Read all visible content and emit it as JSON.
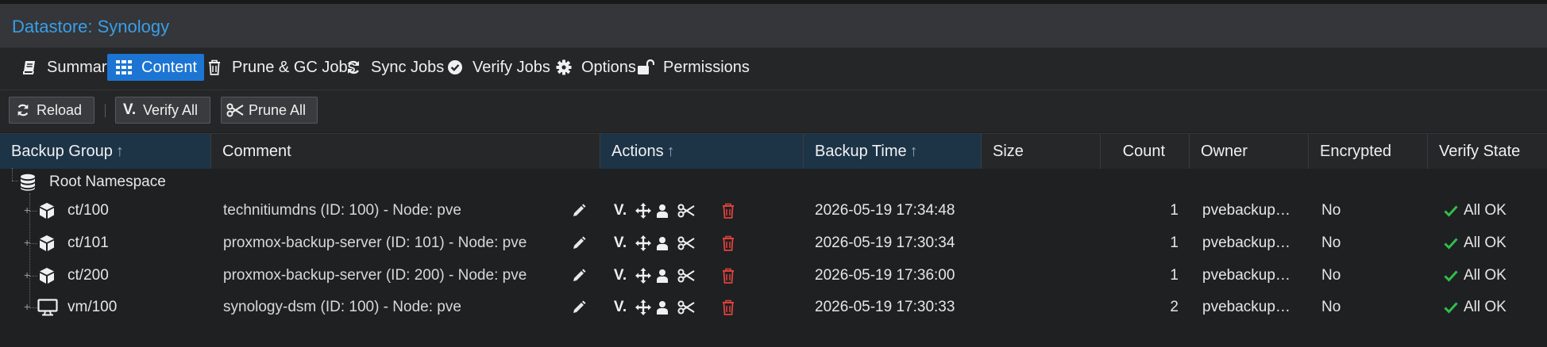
{
  "title": "Datastore: Synology",
  "tabs": [
    {
      "label": "Summary",
      "icon": "book-icon"
    },
    {
      "label": "Content",
      "icon": "grid-icon"
    },
    {
      "label": "Prune & GC Jobs",
      "icon": "trash-icon"
    },
    {
      "label": "Sync Jobs",
      "icon": "sync-icon"
    },
    {
      "label": "Verify Jobs",
      "icon": "check-circle-icon"
    },
    {
      "label": "Options",
      "icon": "gear-icon"
    },
    {
      "label": "Permissions",
      "icon": "unlock-icon"
    }
  ],
  "toolbar": {
    "reload_label": "Reload",
    "verify_label": "Verify All",
    "verify_icon_text": "V.",
    "prune_label": "Prune All"
  },
  "columns": {
    "backup_group": "Backup Group",
    "comment": "Comment",
    "actions": "Actions",
    "backup_time": "Backup Time",
    "size": "Size",
    "count": "Count",
    "owner": "Owner",
    "encrypted": "Encrypted",
    "verify_state": "Verify State",
    "sort_arrow": "↑"
  },
  "namespace": {
    "label": "Root Namespace"
  },
  "action_verify_text": "V.",
  "rows": [
    {
      "group": "ct/100",
      "type_icon": "container-icon",
      "comment": "technitiumdns (ID: 100) - Node: pve",
      "time": "2026-05-19 17:34:48",
      "size": "",
      "count": "1",
      "owner": "pvebackup…",
      "encrypted": "No",
      "verify": "All OK"
    },
    {
      "group": "ct/101",
      "type_icon": "container-icon",
      "comment": "proxmox-backup-server (ID: 101) - Node: pve",
      "time": "2026-05-19 17:30:34",
      "size": "",
      "count": "1",
      "owner": "pvebackup…",
      "encrypted": "No",
      "verify": "All OK"
    },
    {
      "group": "ct/200",
      "type_icon": "container-icon",
      "comment": "proxmox-backup-server (ID: 200) - Node: pve",
      "time": "2026-05-19 17:36:00",
      "size": "",
      "count": "1",
      "owner": "pvebackup…",
      "encrypted": "No",
      "verify": "All OK"
    },
    {
      "group": "vm/100",
      "type_icon": "desktop-icon",
      "comment": "synology-dsm (ID: 100) - Node: pve",
      "time": "2026-05-19 17:30:33",
      "size": "",
      "count": "2",
      "owner": "pvebackup…",
      "encrypted": "No",
      "verify": "All OK"
    }
  ],
  "colors": {
    "accent": "#1d75d3",
    "title": "#3a9ee8",
    "ok": "#2fbf4a",
    "danger": "#e0413c"
  }
}
